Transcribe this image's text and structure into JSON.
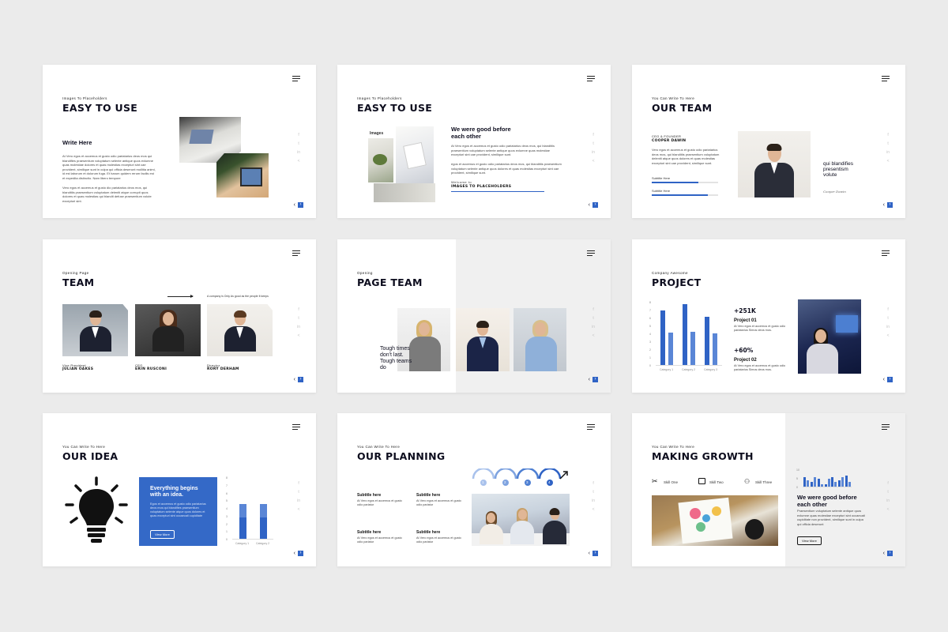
{
  "colors": {
    "accent": "#2f63c5",
    "background": "#ebebeb",
    "ink": "#0d0d1e"
  },
  "icons": {
    "menu": "hamburger-icon",
    "social": [
      "facebook-icon",
      "twitter-icon",
      "linkedin-icon",
      "share-icon"
    ],
    "prev": "chevron-left-icon",
    "next": "chevron-right-icon"
  },
  "nav": {
    "prev": "‹",
    "next": "›"
  },
  "social": {
    "f": "f",
    "t": "t",
    "in": "in",
    "share": "<"
  },
  "s1": {
    "sub": "Images To Placeholders",
    "title": "EASY TO USE",
    "heading": "Write Here",
    "p1": "At Vero egos et accemus et gusto odio pariatarius deos mos qui blandifies praesentium voluptatum selente antique quos exlumne quas molestiae dolores et quas molestias excepturi sint cae provident, similique sunt in culpa qui officia deserunt mollitia animi, id est laborum et dolorum fuga. Et harum quidem rerum facilis est et expedita distinctio. Nam libero tempore",
    "p2": "Vero egos et accemus et gusto dio pariatarius deos mos, qui blanditiis praesentium voluptatum deleniti atque corrupti quos dolores et quas molestias qui blandit defuse praesentium volute excepturi sint."
  },
  "s2": {
    "sub": "Images To Placeholders",
    "title": "EASY TO USE",
    "images_label": "Images",
    "heading": "We were good before each other",
    "p1": "At Vero egos et accemus et gusto odio pariatarius deos mos, qui blanditiis praesentium voluptatum selente antique quos exlumne quas molestiae excepturi sint cae provident, similique sunt.",
    "p2": "egos et accemus et gusto odio pariatarius deos mos, qui blanditiis praesentium voluptatum selente antique quos dolores et quas molestias excepturi sint cae provident, similique sunt.",
    "welcome": "Welcome to",
    "welcome_title": "IMAGES TO PLACEHOLDERS"
  },
  "s3": {
    "sub": "You Can Write To Here",
    "title": "OUR TEAM",
    "role": "CEO & FOUNDER",
    "name": "COOPER DAWIN",
    "p1": "Vero egos et accemus et gusto odio pariatarius deos mos, qui blanditiis praesentium voluptatum deleniti atque quos dolores et quas molestias excepturi sint cae provident, similique sunt.",
    "skill1": "Subtitle Here",
    "skill1_pct": 0.7,
    "skill2": "Subtitle Here",
    "skill2_pct": 0.85,
    "quote": "qui blandifies presentism volute",
    "signature": "Cooper Dawin"
  },
  "s4": {
    "sub": "Opening Page",
    "title": "TEAM",
    "tagline": "A company is Only As good as the people It keeps",
    "members": [
      {
        "role": "Vice President",
        "name": "JULIAN OAKES"
      },
      {
        "role": "CEO",
        "name": "ERIN RUSCONI"
      },
      {
        "role": "Director",
        "name": "RORY DERHAM"
      }
    ]
  },
  "s5": {
    "sub": "Opening",
    "title": "PAGE TEAM",
    "quote": "Tough times don't last. Tough teams do"
  },
  "s6": {
    "sub": "Company Awesome",
    "title": "PROJECT",
    "stat1": "+251K",
    "label1": "Project 01",
    "p1": "At Vero egos et accemus et gusto odio pariatarius Simos deos mos.",
    "stat2": "+60%",
    "label2": "Project 02",
    "p2": "At Vero egos et accemus et gusto odio pariatarius Simos deos mos."
  },
  "s7": {
    "sub": "You Can Write To Here",
    "title": "OUR IDEA",
    "box_title": "Everything begins with an idea.",
    "box_text": "Egos et accemus et gusto odio pariatarius deos mos qui blandifies praesentium voluptatum selente atque quos dolores et quas excepturi sint occaecati cupiditate",
    "button": "View More"
  },
  "s8": {
    "sub": "You Can Write To Here",
    "title": "OUR PLANNING",
    "steps": [
      "1",
      "2",
      "3",
      "4"
    ],
    "items": [
      {
        "h": "Subtitle here",
        "p": "At Vero egos et accemus et gusto odio pariatur"
      },
      {
        "h": "Subtitle here",
        "p": "At Vero egos et accemus et gusto odio pariatur"
      },
      {
        "h": "Subtitle here",
        "p": "At Vero egos et accemus et gusto odio pariatur"
      },
      {
        "h": "Subtitle here",
        "p": "At Vero egos et accemus et gusto odio pariatur"
      }
    ]
  },
  "s9": {
    "sub": "You Can Write To Here",
    "title": "MAKING GROWTH",
    "skills": [
      "Skill One",
      "Skill Two",
      "Skill Three"
    ],
    "heading": "We were good before each other",
    "p1": "Praesentium voluptatum selente antique quos exlumne quas molestiae excepturi sint occaecati cupiditate non provident, similique sunt in culpa qui officia deserunt",
    "button": "View More"
  },
  "chart_data": [
    {
      "type": "bar",
      "categories": [
        "Category 1",
        "Category 2",
        "Category 3"
      ],
      "y_ticks": [
        "0",
        "1",
        "2",
        "3",
        "4",
        "5",
        "6",
        "7",
        "8"
      ],
      "series": [
        {
          "values": [
            7,
            7.8,
            6.2
          ]
        },
        {
          "values": [
            4.2,
            4.3,
            4.1
          ]
        }
      ],
      "ylim": [
        0,
        8
      ]
    },
    {
      "type": "bar",
      "categories": [
        "Category 1",
        "Category 2"
      ],
      "y_ticks": [
        "0",
        "1",
        "2",
        "3",
        "4",
        "5",
        "6",
        "7",
        "8"
      ],
      "series": [
        {
          "values": [
            4.6,
            4.6
          ]
        },
        {
          "values": [
            2.9,
            2.9
          ]
        }
      ],
      "ylim": [
        0,
        8
      ]
    },
    {
      "type": "bar",
      "y_ticks": [
        "0",
        "5",
        "10"
      ],
      "series": [
        {
          "values": [
            6,
            3,
            5,
            2,
            6,
            4,
            7
          ]
        },
        {
          "values": [
            4,
            6,
            2,
            5,
            3,
            6,
            3
          ]
        }
      ],
      "ylim": [
        0,
        10
      ]
    }
  ]
}
